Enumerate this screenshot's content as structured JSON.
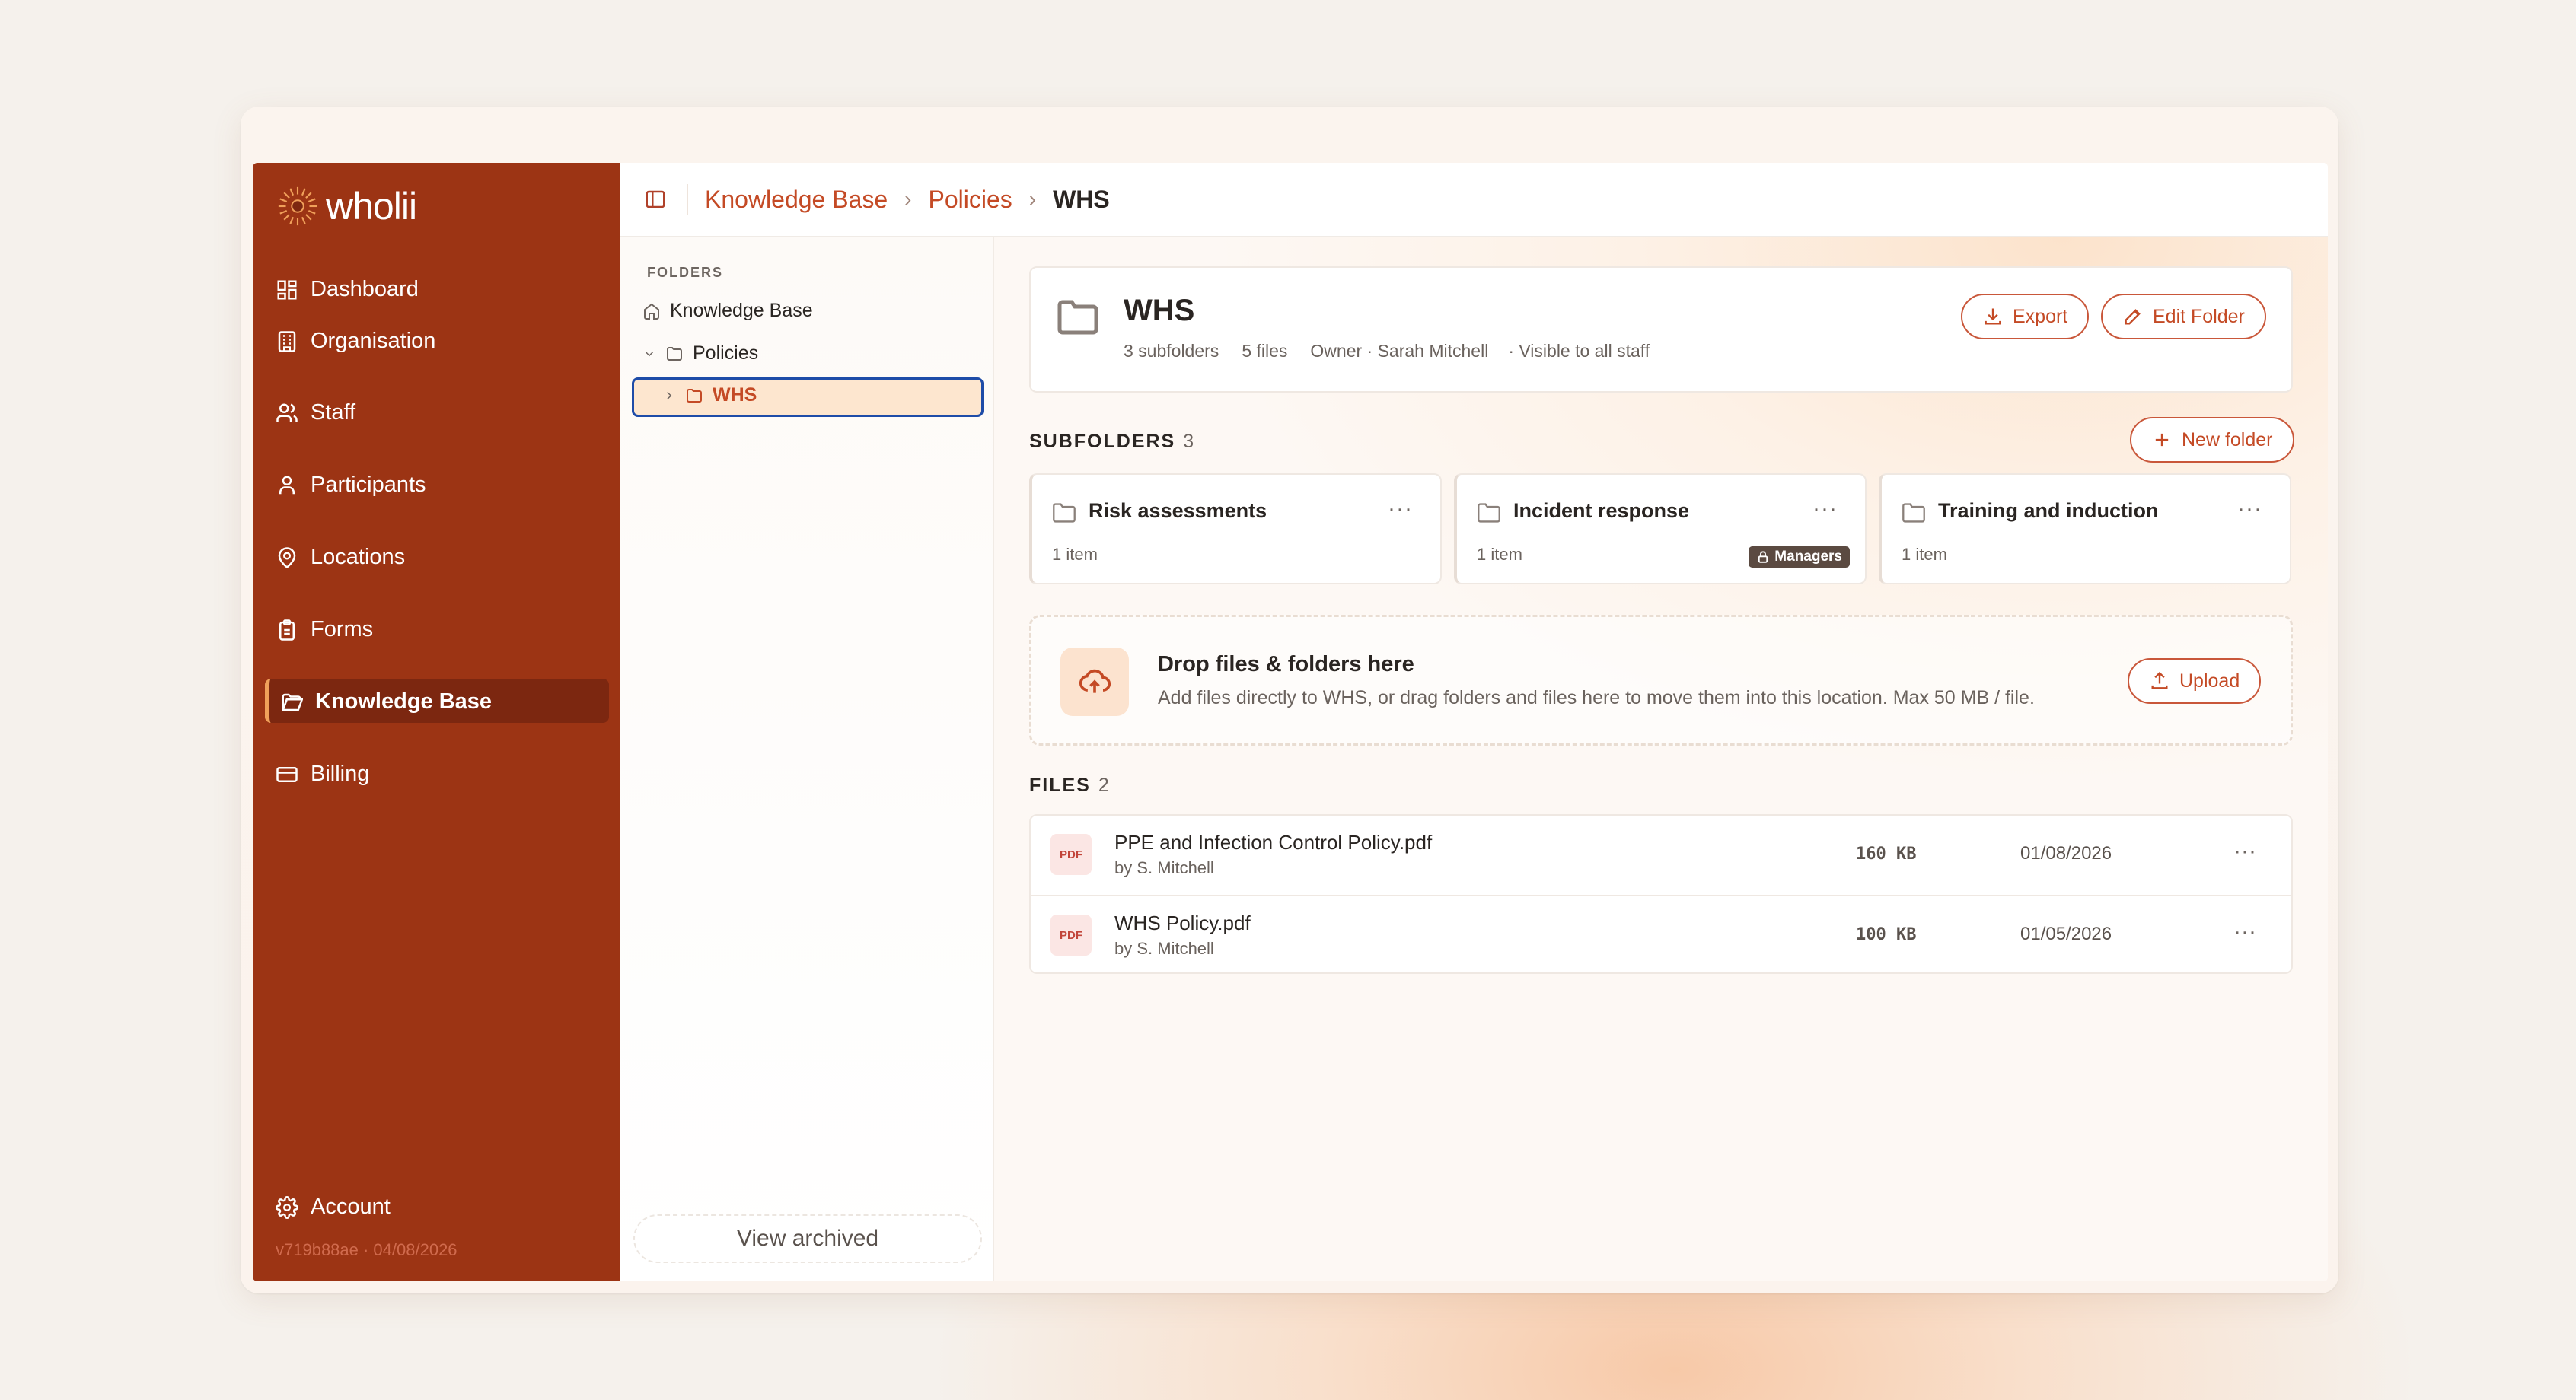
{
  "brand": {
    "name": "wholii"
  },
  "sidebar": {
    "items": [
      {
        "label": "Dashboard",
        "icon": "dashboard-icon"
      },
      {
        "label": "Organisation",
        "icon": "building-icon"
      },
      {
        "label": "Staff",
        "icon": "users-icon"
      },
      {
        "label": "Participants",
        "icon": "user-icon"
      },
      {
        "label": "Locations",
        "icon": "map-pin-icon"
      },
      {
        "label": "Forms",
        "icon": "clipboard-icon"
      },
      {
        "label": "Knowledge Base",
        "icon": "folder-open-icon",
        "active": true
      },
      {
        "label": "Billing",
        "icon": "credit-card-icon"
      }
    ],
    "account_label": "Account",
    "version": "v719b88ae · 04/08/2026"
  },
  "breadcrumb": {
    "items": [
      "Knowledge Base",
      "Policies"
    ],
    "current": "WHS"
  },
  "tree": {
    "heading": "FOLDERS",
    "root": "Knowledge Base",
    "policies": "Policies",
    "selected": "WHS",
    "view_archived": "View archived"
  },
  "folder": {
    "title": "WHS",
    "subfolders_meta": "3 subfolders",
    "files_meta": "5 files",
    "owner_meta": "Owner · Sarah Mitchell",
    "visibility_meta": "· Visible to all staff",
    "export_label": "Export",
    "edit_label": "Edit Folder"
  },
  "subfolders": {
    "label": "SUBFOLDERS",
    "count": "3",
    "new_folder_label": "New folder",
    "items": [
      {
        "title": "Risk assessments",
        "count": "1 item",
        "dots": "···"
      },
      {
        "title": "Incident response",
        "count": "1 item",
        "badge": "Managers",
        "dots": "···"
      },
      {
        "title": "Training and induction",
        "count": "1 item",
        "dots": "···"
      }
    ]
  },
  "dropzone": {
    "title": "Drop files & folders here",
    "subtitle": "Add files directly to WHS, or drag folders and files here to move them into this location. Max 50 MB / file.",
    "upload_label": "Upload"
  },
  "files": {
    "label": "FILES",
    "count": "2",
    "items": [
      {
        "type": "PDF",
        "name": "PPE and Infection Control Policy.pdf",
        "by": "by S. Mitchell",
        "size": "160 KB",
        "date": "01/08/2026",
        "dots": "···"
      },
      {
        "type": "PDF",
        "name": "WHS Policy.pdf",
        "by": "by S. Mitchell",
        "size": "100 KB",
        "date": "01/05/2026",
        "dots": "···"
      }
    ]
  },
  "colors": {
    "sidebar": "#9c3414",
    "accent": "#c44a25",
    "selection_border": "#1e4ca8"
  }
}
